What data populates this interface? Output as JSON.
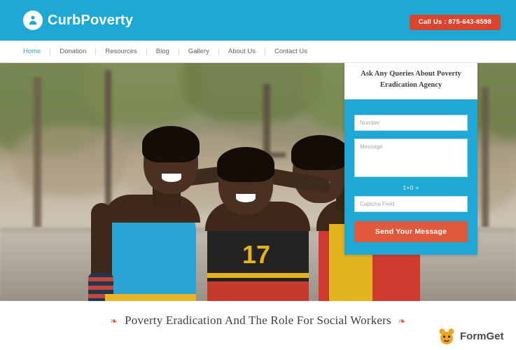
{
  "header": {
    "logo_text": "CurbPoverty",
    "logo_icon": "person-circle-icon",
    "call_button": "Call Us : 875-643-8598"
  },
  "nav": {
    "items": [
      {
        "label": "Home",
        "active": true
      },
      {
        "label": "Donation",
        "active": false
      },
      {
        "label": "Resources",
        "active": false
      },
      {
        "label": "Blog",
        "active": false
      },
      {
        "label": "Gallery",
        "active": false
      },
      {
        "label": "About Us",
        "active": false
      },
      {
        "label": "Contact Us",
        "active": false
      }
    ]
  },
  "form": {
    "title": "Ask Any Queries About Poverty Eradication Agency",
    "number_placeholder": "Number",
    "number_value": "",
    "message_placeholder": "Message",
    "message_value": "",
    "captcha_question": "1+0 =",
    "captcha_placeholder": "Captcha Field",
    "captcha_value": "",
    "submit_label": "Send Your Message"
  },
  "bottom": {
    "heading": "Poverty Eradication And The Role For Social Workers",
    "deco_left": "❧",
    "deco_right": "❧"
  },
  "watermark": {
    "text": "FormGet",
    "icon": "formget-mascot-icon"
  },
  "colors": {
    "brand_blue": "#1fa8d6",
    "call_red": "#d9452f",
    "submit_orange": "#e1593c",
    "text_dark": "#3d4246"
  }
}
